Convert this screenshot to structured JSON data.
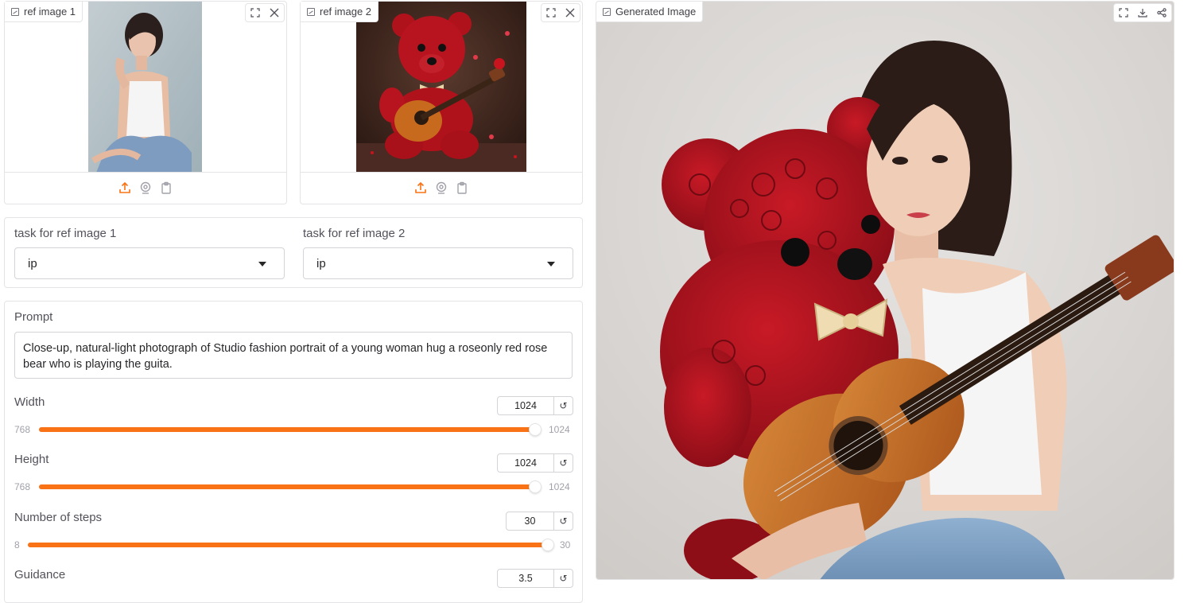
{
  "ref1": {
    "label": "ref image 1",
    "icons": [
      "image-icon",
      "fullscreen-icon",
      "close-icon",
      "upload-icon",
      "webcam-icon",
      "clipboard-icon"
    ]
  },
  "ref2": {
    "label": "ref image 2",
    "icons": [
      "image-icon",
      "fullscreen-icon",
      "close-icon",
      "upload-icon",
      "webcam-icon",
      "clipboard-icon"
    ]
  },
  "tasks": {
    "task1": {
      "label": "task for ref image 1",
      "value": "ip"
    },
    "task2": {
      "label": "task for ref image 2",
      "value": "ip"
    }
  },
  "prompt": {
    "label": "Prompt",
    "value": "Close-up, natural-light photograph of Studio fashion portrait of a young woman hug  a roseonly red rose bear who is playing the guita."
  },
  "sliders": {
    "width": {
      "label": "Width",
      "value": "1024",
      "min": "768",
      "max": "1024",
      "fraction": 1.0
    },
    "height": {
      "label": "Height",
      "value": "1024",
      "min": "768",
      "max": "1024",
      "fraction": 1.0
    },
    "steps": {
      "label": "Number of steps",
      "value": "30",
      "min": "8",
      "max": "30",
      "fraction": 1.0
    },
    "guidance": {
      "label": "Guidance",
      "value": "3.5"
    }
  },
  "reset_glyph": "↺",
  "output": {
    "label": "Generated Image",
    "icons": [
      "image-icon",
      "fullscreen-icon",
      "download-icon",
      "share-icon"
    ]
  },
  "colors": {
    "accent": "#f97316",
    "border": "#e4e4e7",
    "bear_red": "#a3121d",
    "guitar": "#c86a1e"
  }
}
